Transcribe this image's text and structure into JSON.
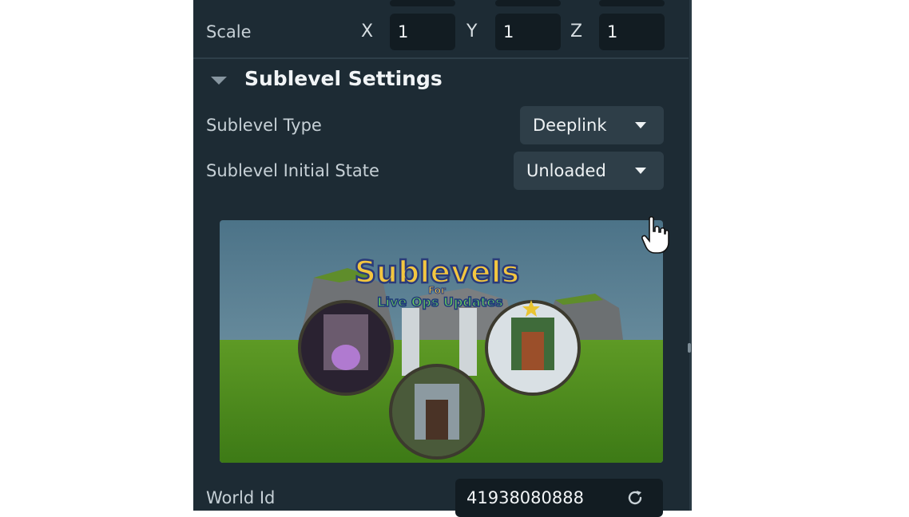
{
  "transform": {
    "scale_label": "Scale",
    "axes": [
      {
        "axis": "X",
        "value": "1"
      },
      {
        "axis": "Y",
        "value": "1"
      },
      {
        "axis": "Z",
        "value": "1"
      }
    ]
  },
  "sublevel_settings": {
    "title": "Sublevel Settings",
    "type_label": "Sublevel Type",
    "type_value": "Deeplink",
    "state_label": "Sublevel Initial State",
    "state_value": "Unloaded",
    "thumbnail": {
      "title_main": "Sublevels",
      "title_for": "For",
      "title_sub": "Live Ops Updates"
    },
    "world_id_label": "World Id",
    "world_id_value": "41938080888"
  },
  "icons": {
    "collapse": "triangle-down-icon",
    "dropdown": "caret-down-icon",
    "refresh": "refresh-icon",
    "cursor": "hand-pointer-icon"
  },
  "colors": {
    "panel_bg": "#1d2b34",
    "field_bg": "#121c22",
    "dropdown_bg": "#2e3e48",
    "text": "#c6d0d6"
  }
}
